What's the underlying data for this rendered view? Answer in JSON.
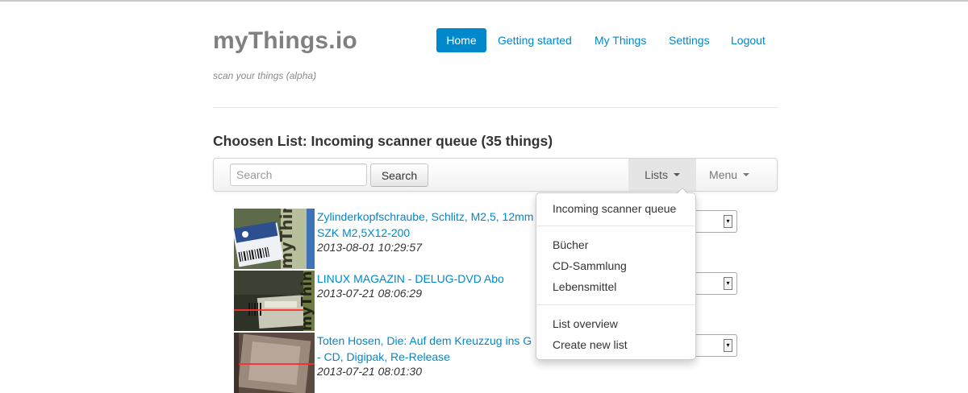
{
  "brand": {
    "title": "myThings.io",
    "tagline": "scan your things (alpha)"
  },
  "nav": {
    "items": [
      {
        "label": "Home",
        "active": true
      },
      {
        "label": "Getting started"
      },
      {
        "label": "My Things"
      },
      {
        "label": "Settings"
      },
      {
        "label": "Logout"
      }
    ]
  },
  "heading": "Choosen List: Incoming scanner queue (35 things)",
  "toolbar": {
    "search_placeholder": "Search",
    "search_value": "",
    "search_button": "Search",
    "lists_label": "Lists",
    "menu_label": "Menu"
  },
  "items": [
    {
      "title_line1": "Zylinderkopfschraube, Schlitz, M2,5, 12mm",
      "title_line2": "SZK M2,5X12-200",
      "timestamp": "2013-08-01 10:29:57",
      "thumb_label": "myThing"
    },
    {
      "title_line1": "LINUX MAGAZIN - DELUG-DVD Abo",
      "title_line2": "",
      "timestamp": "2013-07-21 08:06:29",
      "thumb_label": "myThing"
    },
    {
      "title_line1": "Toten Hosen, Die: Auf dem Kreuzzug ins G",
      "title_line2": "- CD, Digipak, Re-Release",
      "timestamp": "2013-07-21 08:01:30",
      "thumb_label": ""
    }
  ],
  "lists_dropdown": {
    "section1": [
      "Incoming scanner queue"
    ],
    "section2": [
      "Bücher",
      "CD-Sammlung",
      "Lebensmittel"
    ],
    "section3": [
      "List overview",
      "Create new list"
    ]
  },
  "colors": {
    "accent": "#0088cc",
    "brand_gray": "#808080"
  },
  "icons": {
    "caret": "caret-down-icon",
    "select_arrow": "select-arrow-icon"
  }
}
